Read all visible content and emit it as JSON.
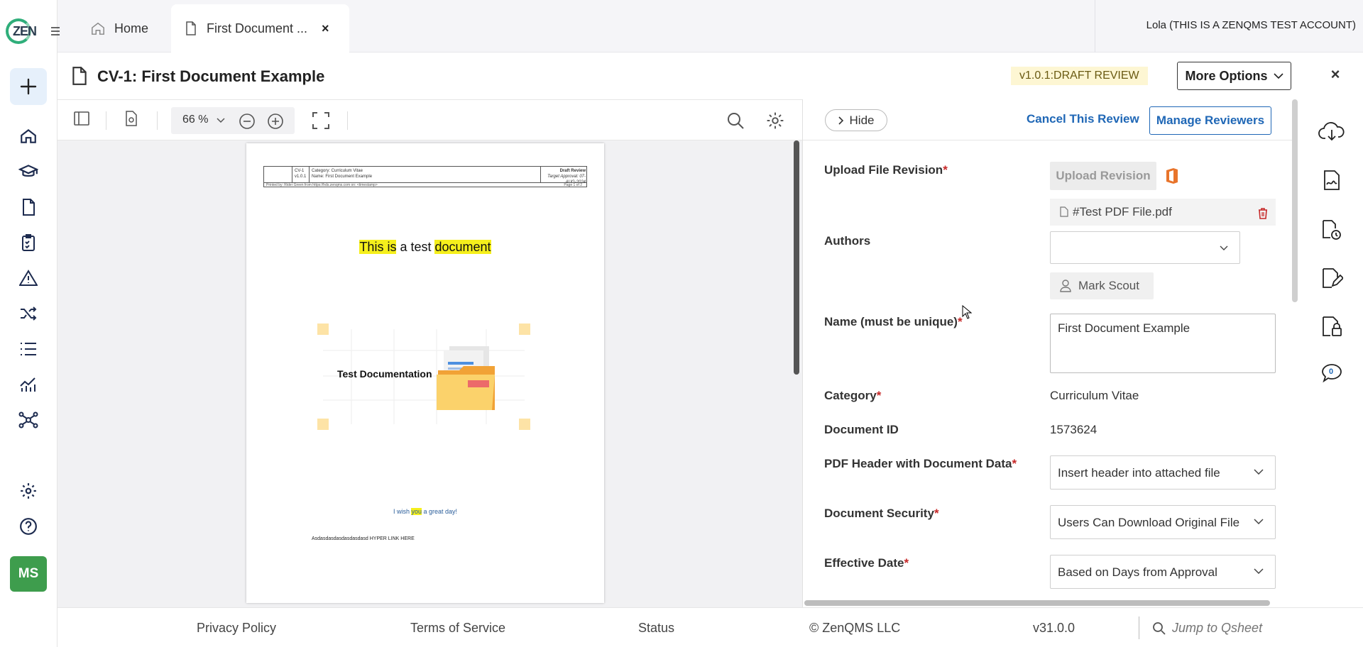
{
  "brand": {
    "logo_text": "ZEN"
  },
  "avatar": {
    "initials": "MS"
  },
  "tabs": [
    {
      "label": "Home"
    },
    {
      "label": "First Document ...",
      "close": "×"
    }
  ],
  "account": {
    "label": "Lola (THIS IS A ZENQMS TEST ACCOUNT)"
  },
  "document": {
    "title": "CV-1: First Document Example",
    "status": "v1.0.1:DRAFT REVIEW",
    "more_options": "More Options",
    "close": "×"
  },
  "viewer": {
    "zoom": "66 %",
    "pdf": {
      "hdr_id": "CV-1",
      "hdr_ver": "v1.0.1",
      "hdr_category": "Category: Curriculum Vitae",
      "hdr_name": "Name: First Document Example",
      "hdr_status": "Draft Review",
      "hdr_target": "Target Approval: 07-AUG-2024",
      "hdr_footer_left": "Printed by: Rider Green from https://hds.zenqms.com on: <timestamp>",
      "hdr_page": "Page 1 of 2",
      "heading_a": "This is",
      "heading_b": " a test ",
      "heading_c": "document",
      "illus_label": "Test Documentation",
      "wish_a": "I wish ",
      "wish_b": "you",
      "wish_c": " a great day!",
      "hyper": "Asdasdasdasdasdasdasd HYPER LINK HERE"
    }
  },
  "panel": {
    "hide": "Hide",
    "cancel_review": "Cancel This Review",
    "manage_reviewers": "Manage Reviewers",
    "fields": {
      "upload_label": "Upload File Revision",
      "upload_button": "Upload Revision",
      "file_name": "#Test PDF File.pdf",
      "authors_label": "Authors",
      "author_chip": "Mark Scout",
      "name_label": "Name (must be unique)",
      "name_value": "First Document Example",
      "category_label": "Category",
      "category_value": "Curriculum Vitae",
      "docid_label": "Document ID",
      "docid_value": "1573624",
      "pdfheader_label": "PDF Header with Document Data",
      "pdfheader_value": "Insert header into attached file",
      "security_label": "Document Security",
      "security_value": "Users Can Download Original File",
      "effective_label": "Effective Date",
      "effective_value": "Based on Days from Approval",
      "required_mark": "*"
    }
  },
  "right_tools": {
    "comments_count": "0"
  },
  "footer": {
    "privacy": "Privacy Policy",
    "terms": "Terms of Service",
    "status": "Status",
    "copyright": "© ZenQMS LLC",
    "version": "v31.0.0",
    "jump_placeholder": "Jump to Qsheet"
  },
  "colors": {
    "accent": "#1f67b6",
    "required": "#c62828",
    "status_bg": "#fdf6d3",
    "avatar_bg": "#3e9d4d",
    "highlight": "#f5ef1c"
  }
}
